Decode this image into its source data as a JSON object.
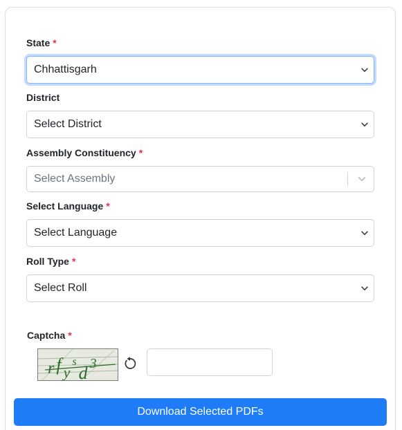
{
  "form": {
    "state": {
      "label": "State",
      "required_mark": "*",
      "value": "Chhattisgarh"
    },
    "district": {
      "label": "District",
      "value": "Select District"
    },
    "assembly": {
      "label": "Assembly Constituency",
      "required_mark": "*",
      "placeholder": "Select Assembly"
    },
    "language": {
      "label": "Select Language",
      "required_mark": "*",
      "value": "Select Language"
    },
    "roll_type": {
      "label": "Roll Type",
      "required_mark": "*",
      "value": "Select Roll"
    },
    "captcha": {
      "label": "Captcha",
      "required_mark": "*",
      "image_text": "rfysd3",
      "input_value": ""
    },
    "download_label": "Download Selected PDFs"
  },
  "colors": {
    "primary": "#1e7cf7",
    "required": "#dc3545",
    "captcha_text": "#2e6b2a",
    "focus_border": "#86b7fe"
  },
  "icons": {
    "select_chevron": "chevron-down-icon",
    "refresh": "refresh-icon"
  }
}
